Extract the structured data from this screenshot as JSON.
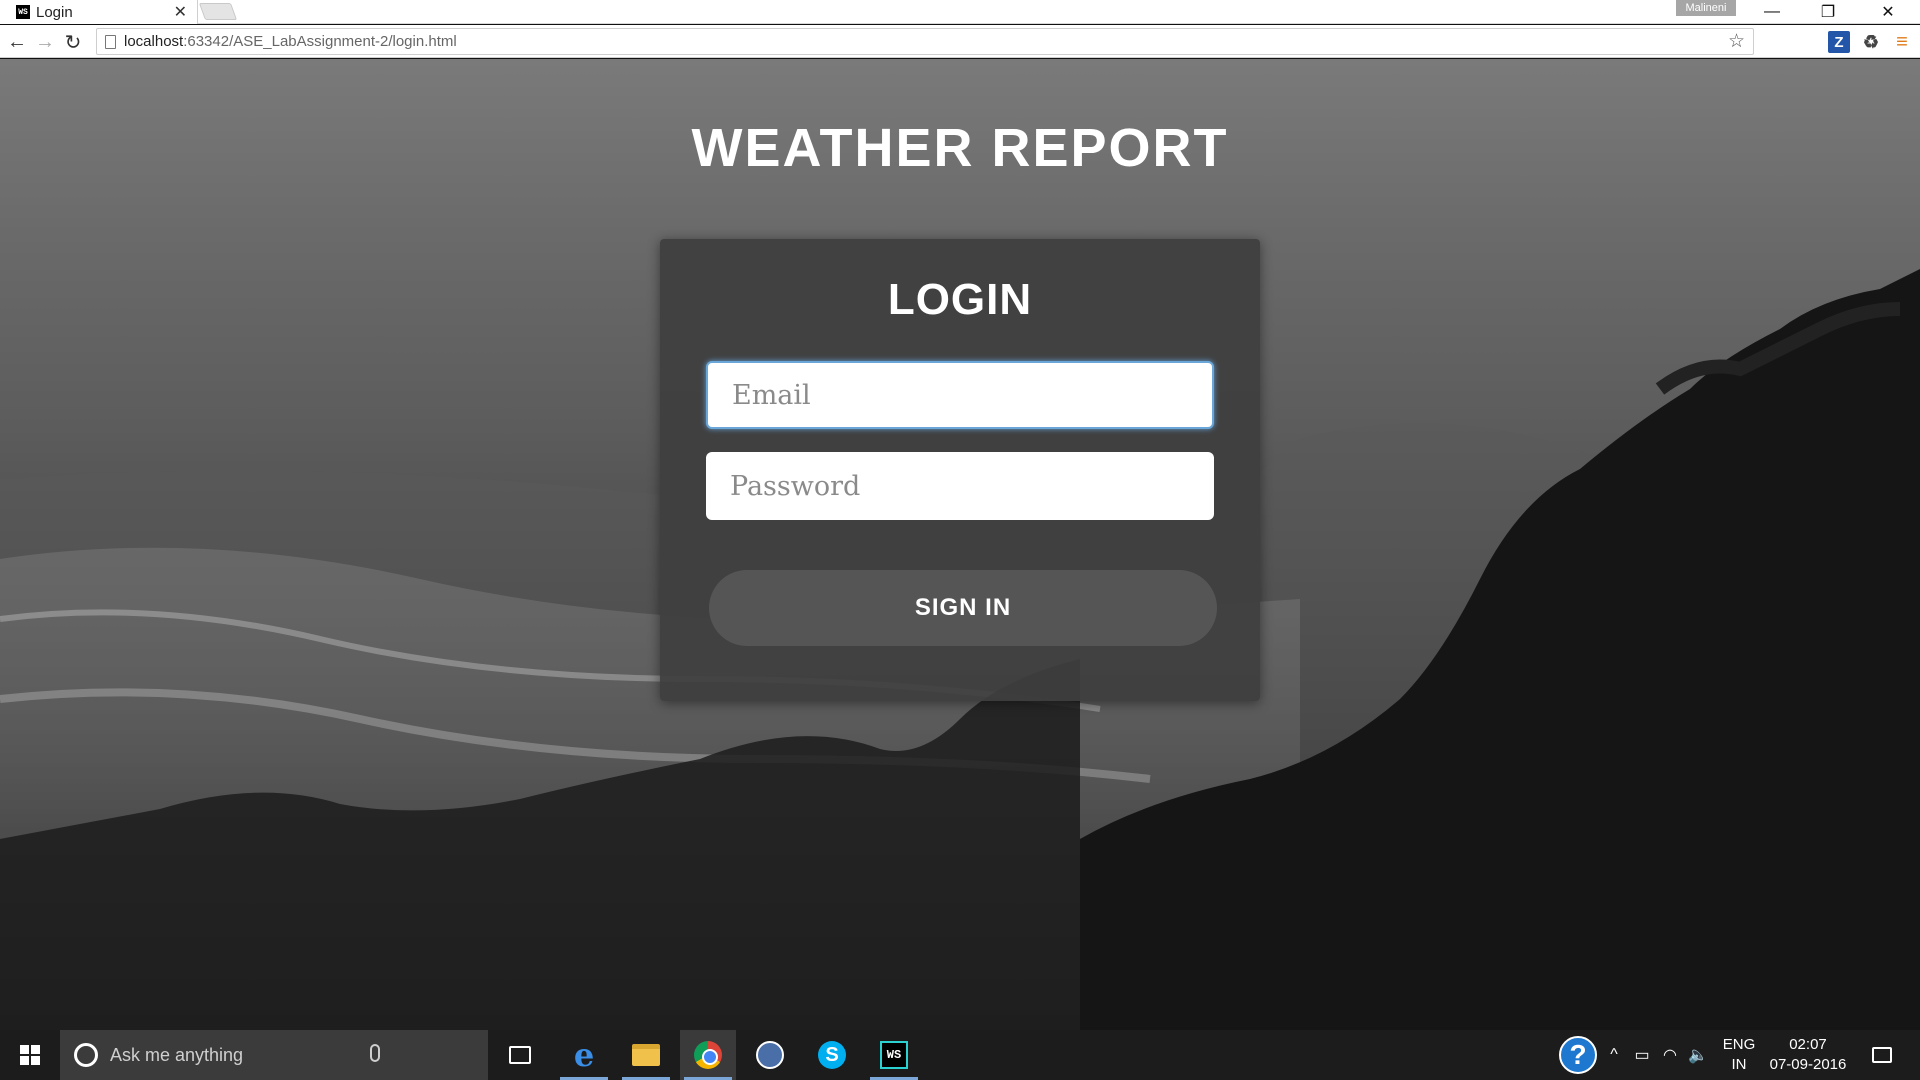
{
  "browser": {
    "tab_title": "Login",
    "tab_favicon": "WS",
    "profile_name": "Malineni",
    "url_host": "localhost",
    "url_path": ":63342/ASE_LabAssignment-2/login.html"
  },
  "page": {
    "site_title": "WEATHER REPORT",
    "login_heading": "LOGIN",
    "email_placeholder": "Email",
    "email_value": "",
    "password_placeholder": "Password",
    "password_value": "",
    "signin_label": "SIGN IN"
  },
  "taskbar": {
    "search_placeholder": "Ask me anything",
    "lang_line1": "ENG",
    "lang_line2": "IN",
    "time": "02:07",
    "date": "07-09-2016",
    "apps": [
      "task-view",
      "edge",
      "file-explorer",
      "chrome",
      "app",
      "skype",
      "webstorm"
    ]
  },
  "colors": {
    "card_bg": "#3e3e3e",
    "button_bg": "#555555",
    "focus_glow": "#6aa7d8",
    "taskbar_bg": "#1c1c1c"
  }
}
